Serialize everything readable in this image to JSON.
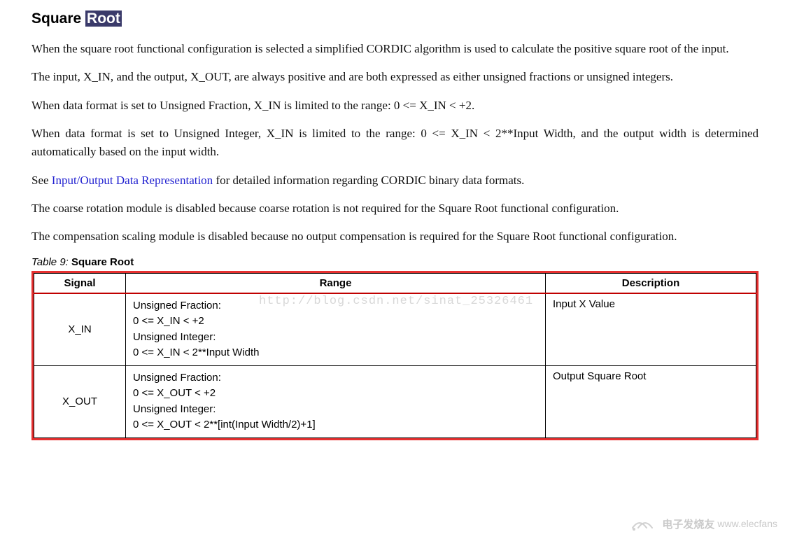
{
  "heading": {
    "text1": "Square ",
    "highlight": "Root"
  },
  "paragraphs": {
    "p1": "When the square root functional configuration is selected a simplified CORDIC algorithm is used to calculate the positive square root of the input.",
    "p2": "The input, X_IN, and the output, X_OUT, are always positive and are both expressed as either unsigned fractions or unsigned integers.",
    "p3": "When data format is set to Unsigned Fraction, X_IN is limited to the range: 0 <= X_IN < +2.",
    "p4": "When data format is set to Unsigned Integer, X_IN is limited to the range: 0 <= X_IN < 2**Input Width, and the output width is determined automatically based on the input width.",
    "p5_pre": "See ",
    "p5_link": "Input/Output Data Representation",
    "p5_post": " for detailed information regarding CORDIC binary data formats.",
    "p6": "The coarse rotation module is disabled because coarse rotation is not required for the Square Root functional configuration.",
    "p7": "The compensation scaling module is disabled because no output compensation is required for the Square Root functional configuration."
  },
  "watermark": "http://blog.csdn.net/sinat_25326461",
  "table_caption": {
    "label": "Table",
    "num": "9:",
    "title": "Square Root"
  },
  "table": {
    "headers": {
      "c0": "Signal",
      "c1": "Range",
      "c2": "Description"
    },
    "rows": [
      {
        "signal": "X_IN",
        "range_l1": "Unsigned Fraction:",
        "range_l2": "0 <= X_IN < +2",
        "range_l3": "Unsigned Integer:",
        "range_l4": "0 <= X_IN < 2**Input Width",
        "desc": "Input X Value"
      },
      {
        "signal": "X_OUT",
        "range_l1": "Unsigned Fraction:",
        "range_l2": "0 <= X_OUT < +2",
        "range_l3": "Unsigned Integer:",
        "range_l4": "0 <= X_OUT < 2**[int(Input Width/2)+1]",
        "desc": "Output Square Root"
      }
    ]
  },
  "footer_logo": {
    "site": "www.elecfans"
  }
}
